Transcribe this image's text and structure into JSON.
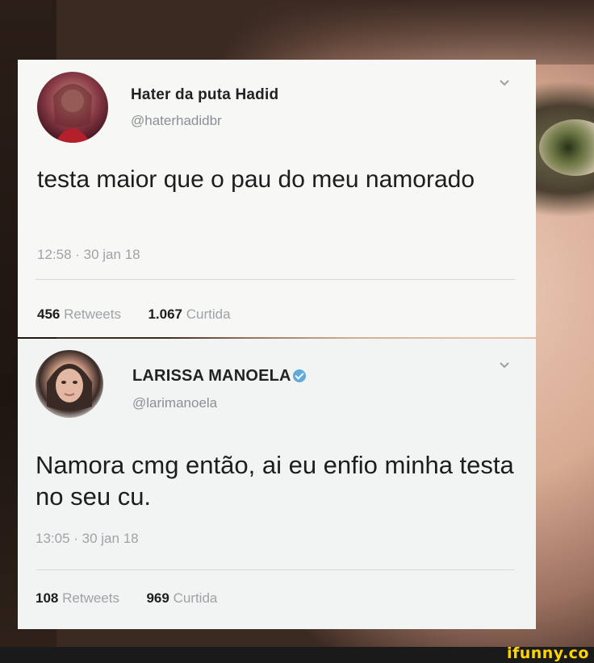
{
  "tweets": [
    {
      "display_name": "Hater da puta Hadid",
      "handle": "@haterhadidbr",
      "verified": false,
      "text": "testa maior que o pau do meu namorado",
      "timestamp": "12:58 · 30 jan 18",
      "retweets_count": "456",
      "retweets_label": "Retweets",
      "likes_count": "1.067",
      "likes_label": "Curtida"
    },
    {
      "display_name": "LARISSA MANOELA",
      "handle": "@larimanoela",
      "verified": true,
      "text": "Namora cmg então, ai eu enfio minha testa no seu cu.",
      "timestamp": "13:05 · 30 jan 18",
      "retweets_count": "108",
      "retweets_label": "Retweets",
      "likes_count": "969",
      "likes_label": "Curtida"
    }
  ],
  "watermark": "ifunny.co",
  "colors": {
    "verified_badge": "#5fa9dd",
    "watermark": "#ffd400",
    "card_background": "#f7f7f6",
    "muted_text": "#9ea3a7"
  },
  "icons": {
    "menu": "chevron-down-icon",
    "verified": "verified-badge-icon"
  }
}
